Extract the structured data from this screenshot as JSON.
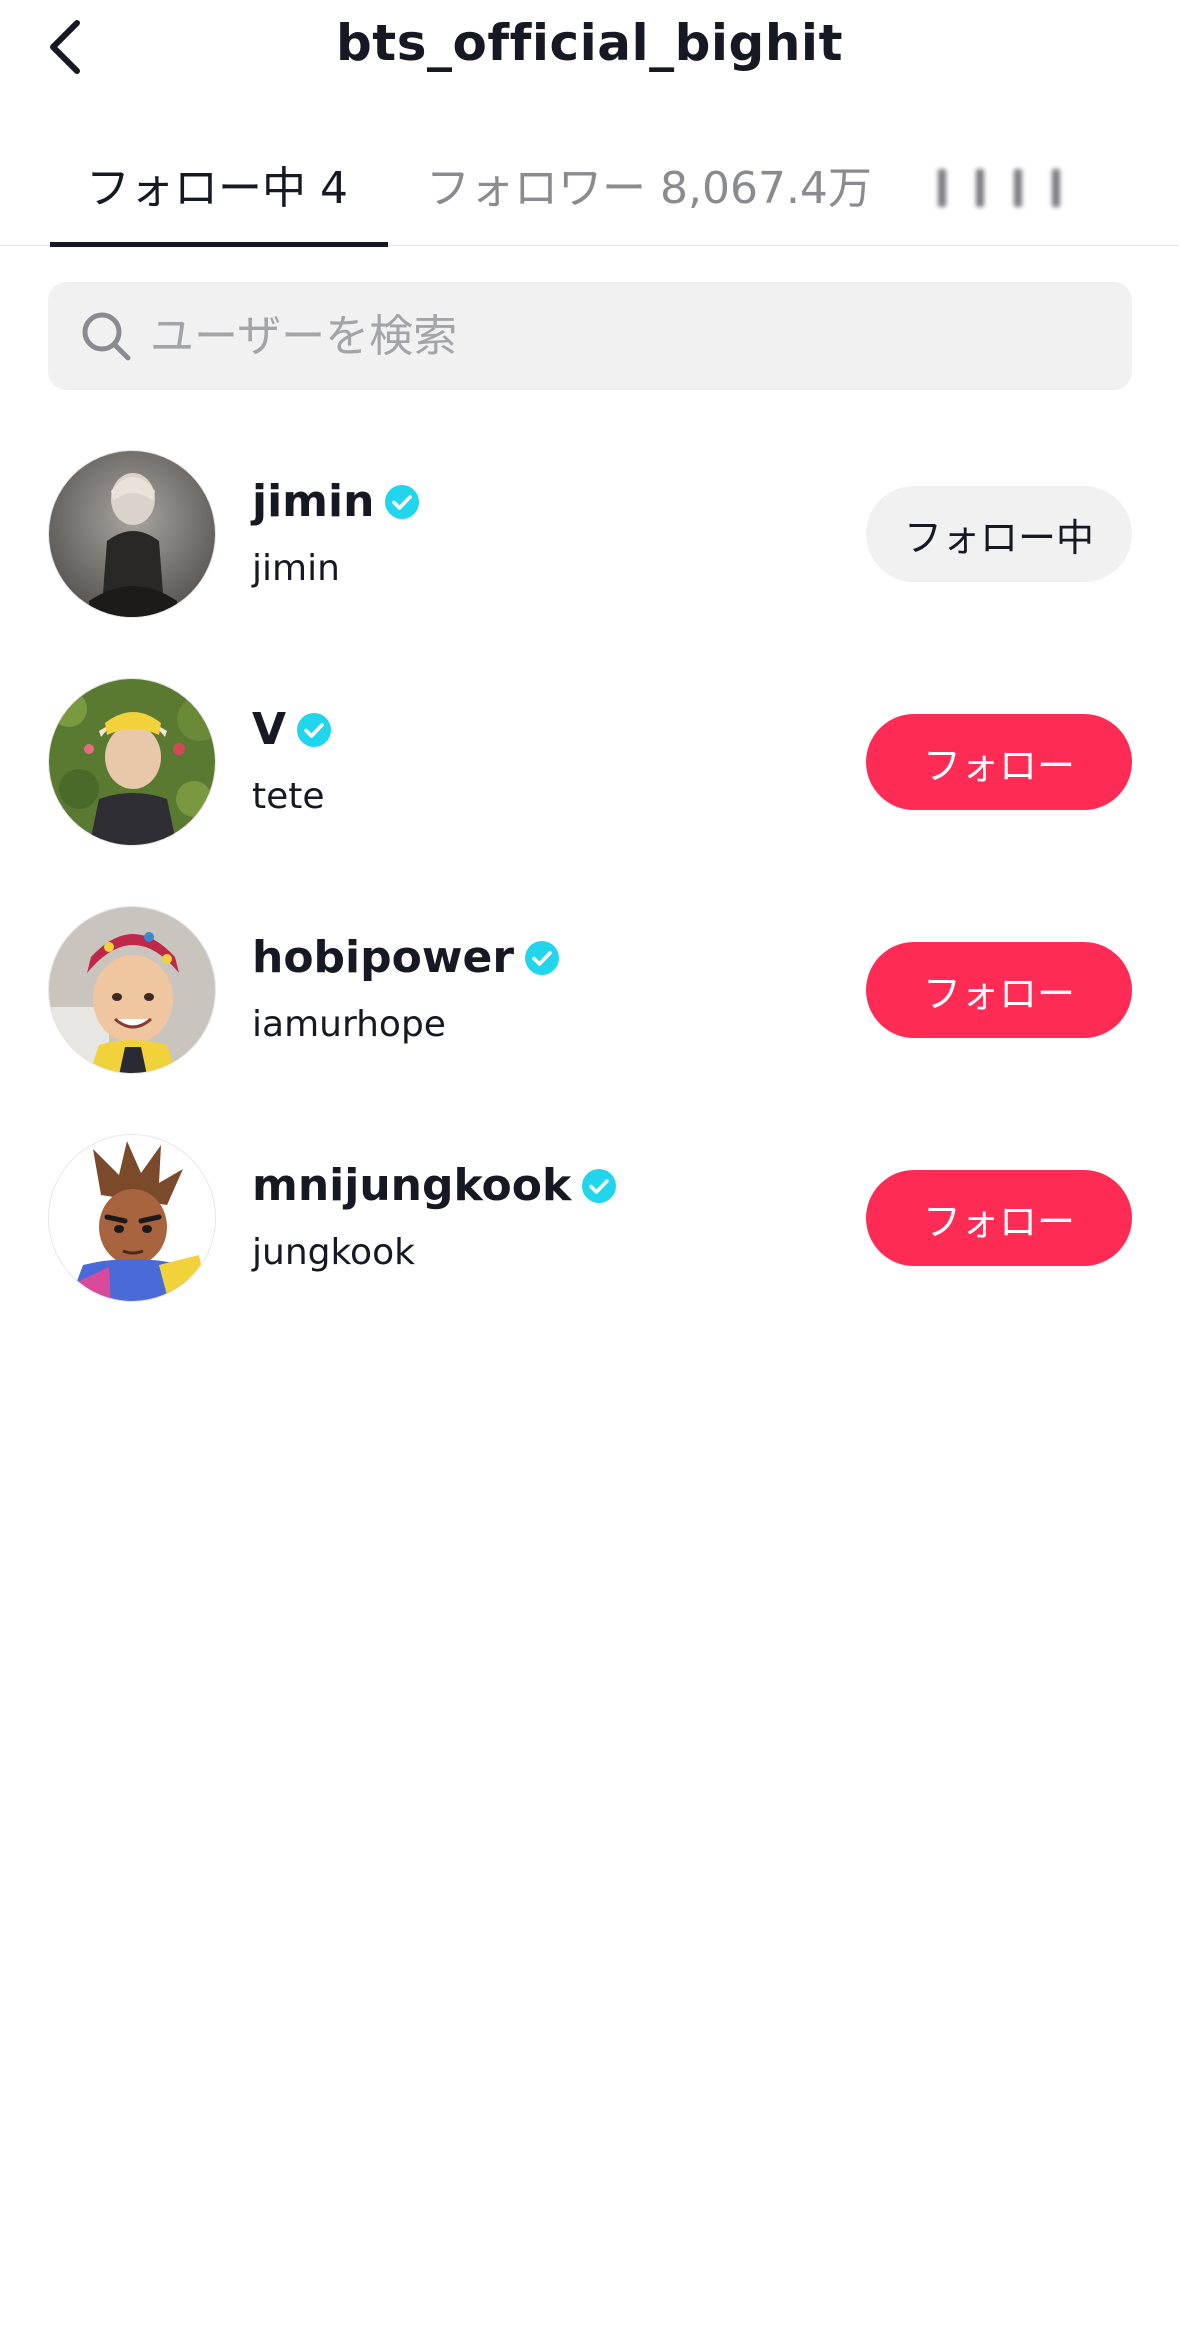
{
  "header": {
    "title": "bts_official_bighit"
  },
  "tabs": [
    {
      "label": "フォロー中 4",
      "active": true
    },
    {
      "label": "フォロワー 8,067.4万",
      "active": false
    }
  ],
  "search": {
    "placeholder": "ユーザーを検索"
  },
  "users": [
    {
      "name": "jimin",
      "handle": "jimin",
      "verified": true,
      "button": "フォロー中",
      "button_state": "following"
    },
    {
      "name": "V",
      "handle": "tete",
      "verified": true,
      "button": "フォロー",
      "button_state": "follow"
    },
    {
      "name": "hobipower",
      "handle": "iamurhope",
      "verified": true,
      "button": "フォロー",
      "button_state": "follow"
    },
    {
      "name": "mnijungkook",
      "handle": "jungkook",
      "verified": true,
      "button": "フォロー",
      "button_state": "follow"
    }
  ],
  "colors": {
    "follow_button": "#fe2c55",
    "following_button": "#f1f1f2",
    "verified_badge": "#20d5ec",
    "text_primary": "#161823",
    "text_secondary": "#8a8b91"
  },
  "icons": {
    "back": "chevron-left-icon",
    "search": "search-icon",
    "verified": "verified-badge-icon"
  }
}
